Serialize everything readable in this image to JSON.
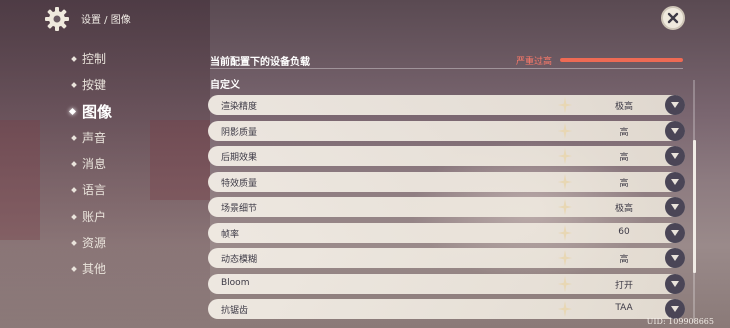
{
  "breadcrumb": "设置 / 图像",
  "sidebar": {
    "items": [
      {
        "label": "控制",
        "active": false
      },
      {
        "label": "按键",
        "active": false
      },
      {
        "label": "图像",
        "active": true
      },
      {
        "label": "声音",
        "active": false
      },
      {
        "label": "消息",
        "active": false
      },
      {
        "label": "语言",
        "active": false
      },
      {
        "label": "账户",
        "active": false
      },
      {
        "label": "资源",
        "active": false
      },
      {
        "label": "其他",
        "active": false
      }
    ]
  },
  "device_load": {
    "title": "当前配置下的设备负载",
    "status": "严重过高",
    "level": 1.0,
    "color": "#ee6a54"
  },
  "section_title": "自定义",
  "settings": [
    {
      "label": "渲染精度",
      "value": "极高"
    },
    {
      "label": "阴影质量",
      "value": "高"
    },
    {
      "label": "后期效果",
      "value": "高"
    },
    {
      "label": "特效质量",
      "value": "高"
    },
    {
      "label": "场景细节",
      "value": "极高"
    },
    {
      "label": "帧率",
      "value": "60"
    },
    {
      "label": "动态模糊",
      "value": "高"
    },
    {
      "label": "Bloom",
      "value": "打开"
    },
    {
      "label": "抗锯齿",
      "value": "TAA"
    }
  ],
  "scroll": {
    "position": 0.55,
    "visible_fraction": 0.55
  },
  "uid": "UID: 109908665"
}
